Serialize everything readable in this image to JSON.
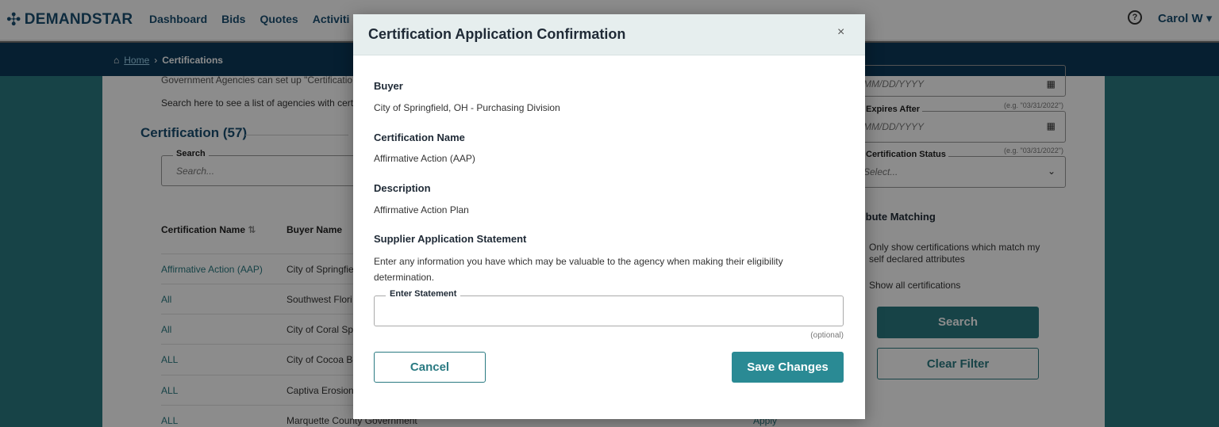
{
  "app": {
    "logo_text": "DEMANDSTAR",
    "nav": [
      "Dashboard",
      "Bids",
      "Quotes",
      "Activiti"
    ],
    "help_icon": "?",
    "user_label": "Carol W"
  },
  "breadcrumb": {
    "home": "Home",
    "current": "Certifications"
  },
  "page": {
    "intro_line1": "Government Agencies can set up \"Certificatio",
    "intro_line2": "Search here to see a list of agencies with certi",
    "heading": "Certification (57)",
    "search": {
      "label": "Search",
      "placeholder": "Search..."
    },
    "table": {
      "headers": [
        "Certification Name",
        "Buyer Name"
      ],
      "rows": [
        {
          "name": "Affirmative Action (AAP)",
          "buyer": "City of Springfie",
          "action": ""
        },
        {
          "name": "All",
          "buyer": "Southwest Flori",
          "action": ""
        },
        {
          "name": "All",
          "buyer": "City of Coral Sp",
          "action": ""
        },
        {
          "name": "ALL",
          "buyer": "City of Cocoa Be",
          "action": ""
        },
        {
          "name": "ALL",
          "buyer": "Captiva Erosion",
          "action": ""
        },
        {
          "name": "ALL",
          "buyer": "Marquette County Government",
          "action": "Apply"
        }
      ]
    },
    "filters": {
      "date1": {
        "placeholder": "MM/DD/YYYY"
      },
      "expires_after": {
        "label": "Expires After",
        "example": "(e.g. \"03/31/2022\")",
        "placeholder": "MM/DD/YYYY"
      },
      "status": {
        "label": "Certification Status",
        "example": "(e.g. \"03/31/2022\")",
        "placeholder": "Select..."
      },
      "attribute_heading": "ribute Matching",
      "radio1": "Only show certifications which match my self declared attributes",
      "radio2": "Show all certifications",
      "search_button": "Search",
      "clear_button": "Clear Filter"
    }
  },
  "modal": {
    "title": "Certification Application Confirmation",
    "close": "×",
    "buyer_label": "Buyer",
    "buyer_value": "City of Springfield, OH - Purchasing Division",
    "cert_name_label": "Certification Name",
    "cert_name_value": "Affirmative Action (AAP)",
    "description_label": "Description",
    "description_value": "Affirmative Action Plan",
    "statement_label": "Supplier Application Statement",
    "statement_help": "Enter any information you have which may be valuable to the agency when making their eligibility determination.",
    "statement_field_label": "Enter Statement",
    "statement_value": "",
    "optional_text": "(optional)",
    "cancel_label": "Cancel",
    "save_label": "Save Changes"
  }
}
